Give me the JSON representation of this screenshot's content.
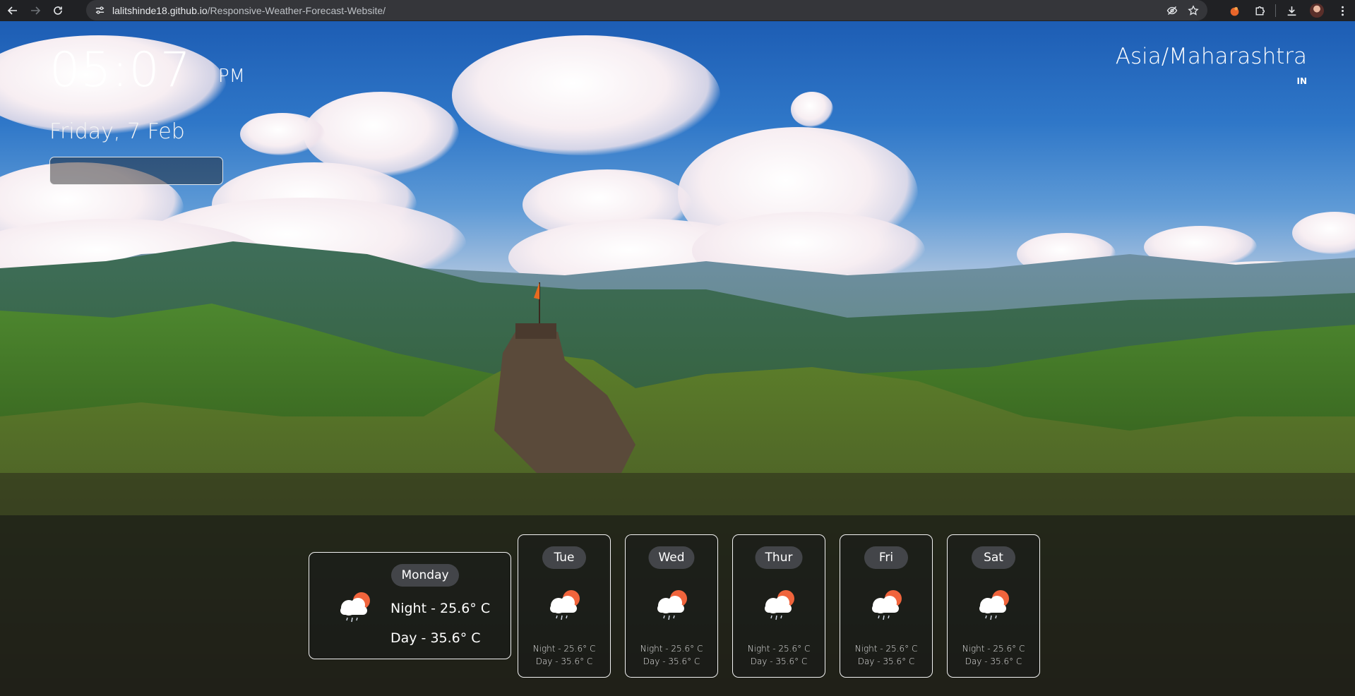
{
  "browser": {
    "url_host": "lalitshinde18.github.io",
    "url_path": "/Responsive-Weather-Forecast-Website/"
  },
  "clock": {
    "time": "05:07",
    "ampm": "PM",
    "date": "Friday, 7 Feb"
  },
  "location": {
    "timezone": "Asia/Maharashtra",
    "country": "IN"
  },
  "forecast": {
    "today": {
      "day": "Monday",
      "night": "Night - 25.6° C",
      "dayt": "Day - 35.6° C",
      "icon": "cloud-sun-rain-icon"
    },
    "days": [
      {
        "day": "Tue",
        "night": "Night - 25.6° C",
        "dayt": "Day - 35.6° C",
        "icon": "cloud-sun-rain-icon"
      },
      {
        "day": "Wed",
        "night": "Night - 25.6° C",
        "dayt": "Day - 35.6° C",
        "icon": "cloud-sun-rain-icon"
      },
      {
        "day": "Thur",
        "night": "Night - 25.6° C",
        "dayt": "Day - 35.6° C",
        "icon": "cloud-sun-rain-icon"
      },
      {
        "day": "Fri",
        "night": "Night - 25.6° C",
        "dayt": "Day - 35.6° C",
        "icon": "cloud-sun-rain-icon"
      },
      {
        "day": "Sat",
        "night": "Night - 25.6° C",
        "dayt": "Day - 35.6° C",
        "icon": "cloud-sun-rain-icon"
      }
    ]
  }
}
